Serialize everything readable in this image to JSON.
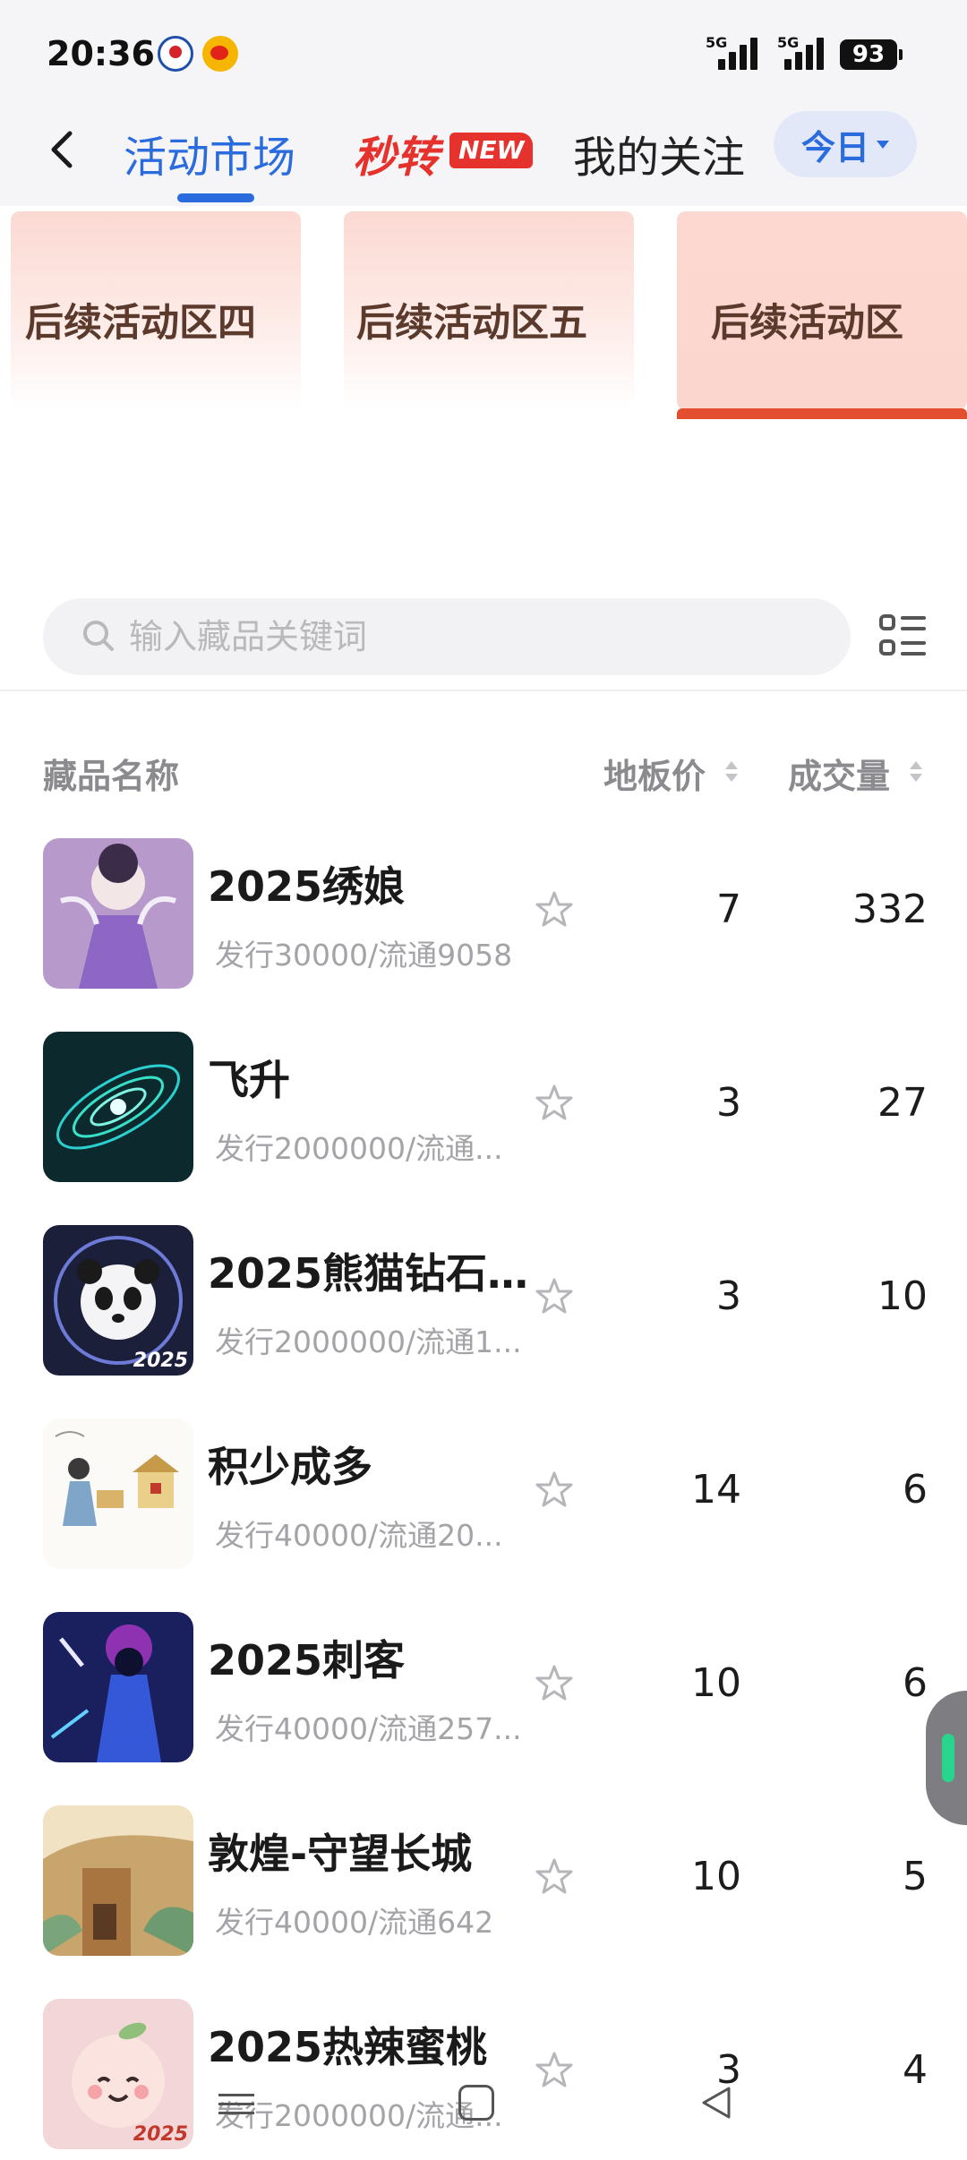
{
  "status_bar": {
    "time": "20:36",
    "network_1": "5G",
    "network_2": "5G",
    "battery": "93"
  },
  "header": {
    "tabs": [
      {
        "label": "活动市场",
        "active": true
      },
      {
        "label": "秒转",
        "badge": "NEW"
      },
      {
        "label": "我的关注"
      }
    ],
    "period_button": "今日",
    "accent_color": "#2a6bde",
    "flash_color": "#e5322d"
  },
  "areas": [
    {
      "label": "后续活动区四"
    },
    {
      "label": "后续活动区五"
    },
    {
      "label": "后续活动区",
      "selected": true
    }
  ],
  "search": {
    "placeholder": "输入藏品关键词",
    "value": ""
  },
  "table": {
    "columns": {
      "name": "藏品名称",
      "price": "地板价",
      "volume": "成交量"
    },
    "rows": [
      {
        "name": "2025绣娘",
        "sub": "发行30000/流通9058",
        "price": "7",
        "volume": "332",
        "thumb": "embroidery-lady"
      },
      {
        "name": "飞升",
        "sub": "发行2000000/流通...",
        "price": "3",
        "volume": "27",
        "thumb": "cosmic-vortex"
      },
      {
        "name": "2025熊猫钻石...",
        "sub": "发行2000000/流通1...",
        "price": "3",
        "volume": "10",
        "thumb": "panda",
        "tag": "2025"
      },
      {
        "name": "积少成多",
        "sub": "发行40000/流通20...",
        "price": "14",
        "volume": "6",
        "thumb": "ink-sketch"
      },
      {
        "name": "2025刺客",
        "sub": "发行40000/流通257...",
        "price": "10",
        "volume": "6",
        "thumb": "assassin"
      },
      {
        "name": "敦煌-守望长城",
        "sub": "发行40000/流通642",
        "price": "10",
        "volume": "5",
        "thumb": "great-wall"
      },
      {
        "name": "2025热辣蜜桃",
        "sub": "发行2000000/流通...",
        "price": "3",
        "volume": "4",
        "thumb": "peach",
        "tag": "2025"
      }
    ]
  }
}
